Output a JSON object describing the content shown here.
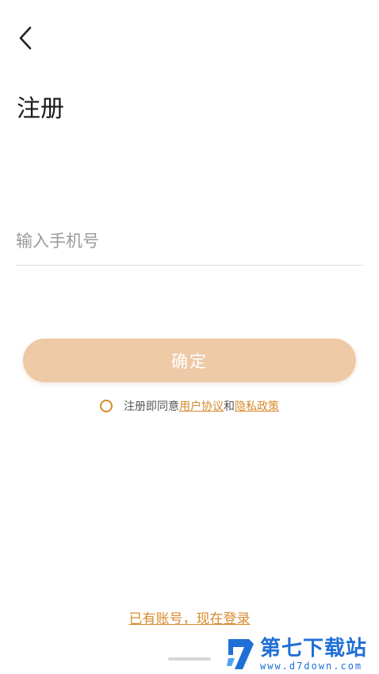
{
  "header": {
    "back_icon": "chevron-left-icon",
    "title": "注册"
  },
  "form": {
    "phone_placeholder": "输入手机号",
    "phone_value": "",
    "confirm_label": "确定"
  },
  "agreement": {
    "prefix": "注册即同意",
    "user_agreement": "用户协议",
    "conjunction": "和",
    "privacy_policy": "隐私政策",
    "checked": false
  },
  "footer": {
    "login_link": "已有账号，现在登录"
  },
  "watermark": {
    "title": "第七下载站",
    "url": "www.d7down.com"
  },
  "colors": {
    "accent": "#d88a2c",
    "button_bg": "#eec9a6",
    "watermark": "#1f6fd6"
  }
}
